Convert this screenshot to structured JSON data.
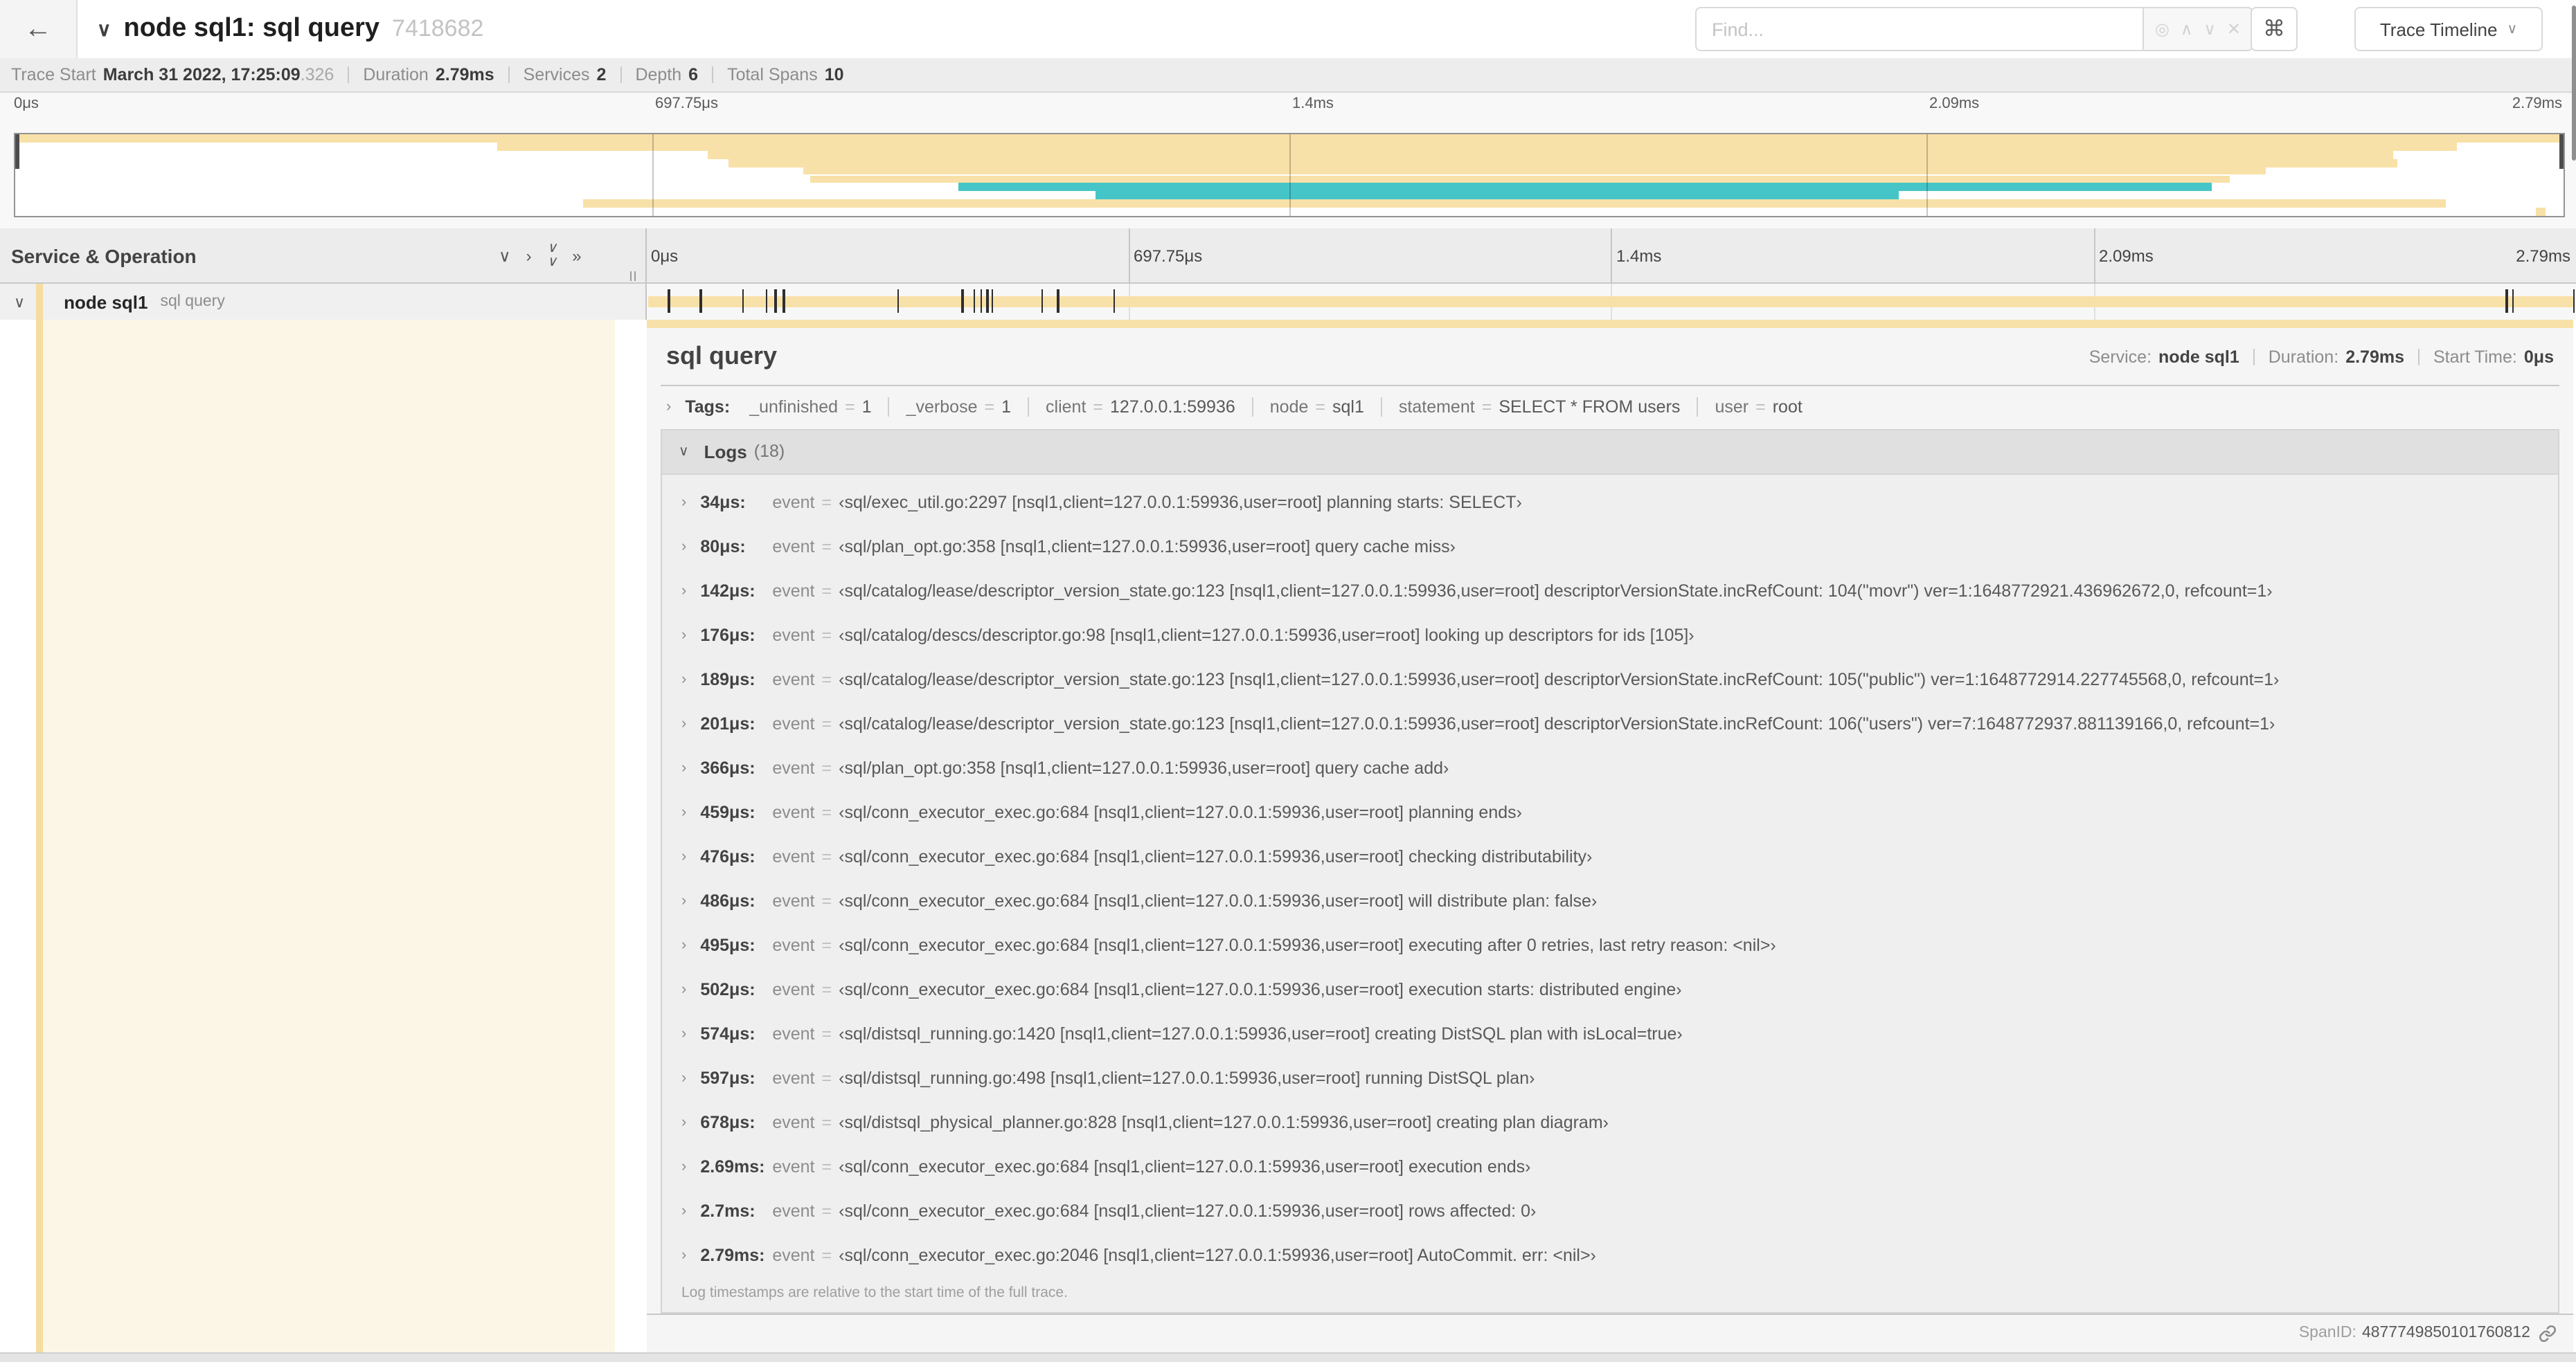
{
  "colors": {
    "tan": "#F8E1A8",
    "teal": "#45C5C8",
    "cream": "#FCF6E7",
    "accent": "#F6DC9F"
  },
  "header": {
    "back_arrow": "←",
    "collapse_chevron": "∨",
    "title": "node sql1: sql query",
    "trace_id": "7418682",
    "find_placeholder": "Find...",
    "shortcut_glyph": "⌘",
    "view_selector": "Trace Timeline"
  },
  "trace_info": {
    "items": [
      {
        "label": "Trace Start",
        "value": "March 31 2022, 17:25:09",
        "suffix": ".326"
      },
      {
        "label": "Duration",
        "value": "2.79ms"
      },
      {
        "label": "Services",
        "value": "2"
      },
      {
        "label": "Depth",
        "value": "6"
      },
      {
        "label": "Total Spans",
        "value": "10"
      }
    ]
  },
  "minimap": {
    "axis": [
      {
        "text": "0μs",
        "pct": 0
      },
      {
        "text": "697.75μs",
        "pct": 25
      },
      {
        "text": "1.4ms",
        "pct": 50
      },
      {
        "text": "2.09ms",
        "pct": 75
      },
      {
        "text": "2.79ms",
        "pct": 100
      }
    ],
    "tick_pcts": [
      25,
      50,
      75
    ],
    "spans": [
      {
        "start": 0,
        "end": 100,
        "color": "tan"
      },
      {
        "start": 18.9,
        "end": 95.8,
        "color": "tan"
      },
      {
        "start": 27.2,
        "end": 93.3,
        "color": "tan"
      },
      {
        "start": 28.0,
        "end": 93.5,
        "color": "tan"
      },
      {
        "start": 30.9,
        "end": 88.3,
        "color": "tan"
      },
      {
        "start": 31.2,
        "end": 86.9,
        "color": "tan"
      },
      {
        "start": 37.0,
        "end": 86.2,
        "color": "teal"
      },
      {
        "start": 42.4,
        "end": 73.9,
        "color": "teal"
      },
      {
        "start": 22.3,
        "end": 95.4,
        "color": "tan"
      },
      {
        "start": 98.9,
        "end": 99.3,
        "color": "tan"
      }
    ]
  },
  "timeline": {
    "left_header": "Service & Operation",
    "ruler": [
      {
        "text": "0μs",
        "pct": 0
      },
      {
        "text": "697.75μs",
        "pct": 25
      },
      {
        "text": "1.4ms",
        "pct": 50
      },
      {
        "text": "2.09ms",
        "pct": 75
      },
      {
        "text": "2.79ms",
        "pct": 100
      }
    ],
    "grid_pcts": [
      25,
      50,
      75
    ],
    "span_row": {
      "collapse_chevron": "∨",
      "service": "node sql1",
      "operation": "sql query",
      "log_marker_pcts": [
        1.22,
        2.87,
        5.09,
        6.31,
        6.77,
        7.2,
        13.12,
        16.45,
        17.06,
        17.42,
        17.74,
        17.99,
        20.57,
        21.4,
        24.3,
        96.42,
        96.77,
        99.9
      ]
    }
  },
  "detail": {
    "title": "sql query",
    "meta": [
      {
        "label": "Service:",
        "value": "node sql1"
      },
      {
        "label": "Duration:",
        "value": "2.79ms"
      },
      {
        "label": "Start Time:",
        "value": "0μs"
      }
    ],
    "tags": {
      "label": "Tags:",
      "items": [
        {
          "key": "_unfinished",
          "value": "1"
        },
        {
          "key": "_verbose",
          "value": "1"
        },
        {
          "key": "client",
          "value": "127.0.0.1:59936"
        },
        {
          "key": "node",
          "value": "sql1"
        },
        {
          "key": "statement",
          "value": "SELECT * FROM users"
        },
        {
          "key": "user",
          "value": "root"
        }
      ]
    },
    "logs": {
      "label": "Logs",
      "count_display": "(18)",
      "entries": [
        {
          "time": "34μs:",
          "key": "event",
          "value": "‹sql/exec_util.go:2297 [nsql1,client=127.0.0.1:59936,user=root] planning starts: SELECT›"
        },
        {
          "time": "80μs:",
          "key": "event",
          "value": "‹sql/plan_opt.go:358 [nsql1,client=127.0.0.1:59936,user=root] query cache miss›"
        },
        {
          "time": "142μs:",
          "key": "event",
          "value": "‹sql/catalog/lease/descriptor_version_state.go:123 [nsql1,client=127.0.0.1:59936,user=root] descriptorVersionState.incRefCount: 104(\"movr\") ver=1:1648772921.436962672,0, refcount=1›"
        },
        {
          "time": "176μs:",
          "key": "event",
          "value": "‹sql/catalog/descs/descriptor.go:98 [nsql1,client=127.0.0.1:59936,user=root] looking up descriptors for ids [105]›"
        },
        {
          "time": "189μs:",
          "key": "event",
          "value": "‹sql/catalog/lease/descriptor_version_state.go:123 [nsql1,client=127.0.0.1:59936,user=root] descriptorVersionState.incRefCount: 105(\"public\") ver=1:1648772914.227745568,0, refcount=1›"
        },
        {
          "time": "201μs:",
          "key": "event",
          "value": "‹sql/catalog/lease/descriptor_version_state.go:123 [nsql1,client=127.0.0.1:59936,user=root] descriptorVersionState.incRefCount: 106(\"users\") ver=7:1648772937.881139166,0, refcount=1›"
        },
        {
          "time": "366μs:",
          "key": "event",
          "value": "‹sql/plan_opt.go:358 [nsql1,client=127.0.0.1:59936,user=root] query cache add›"
        },
        {
          "time": "459μs:",
          "key": "event",
          "value": "‹sql/conn_executor_exec.go:684 [nsql1,client=127.0.0.1:59936,user=root] planning ends›"
        },
        {
          "time": "476μs:",
          "key": "event",
          "value": "‹sql/conn_executor_exec.go:684 [nsql1,client=127.0.0.1:59936,user=root] checking distributability›"
        },
        {
          "time": "486μs:",
          "key": "event",
          "value": "‹sql/conn_executor_exec.go:684 [nsql1,client=127.0.0.1:59936,user=root] will distribute plan: false›"
        },
        {
          "time": "495μs:",
          "key": "event",
          "value": "‹sql/conn_executor_exec.go:684 [nsql1,client=127.0.0.1:59936,user=root] executing after 0 retries, last retry reason: <nil>›"
        },
        {
          "time": "502μs:",
          "key": "event",
          "value": "‹sql/conn_executor_exec.go:684 [nsql1,client=127.0.0.1:59936,user=root] execution starts: distributed engine›"
        },
        {
          "time": "574μs:",
          "key": "event",
          "value": "‹sql/distsql_running.go:1420 [nsql1,client=127.0.0.1:59936,user=root] creating DistSQL plan with isLocal=true›"
        },
        {
          "time": "597μs:",
          "key": "event",
          "value": "‹sql/distsql_running.go:498 [nsql1,client=127.0.0.1:59936,user=root] running DistSQL plan›"
        },
        {
          "time": "678μs:",
          "key": "event",
          "value": "‹sql/distsql_physical_planner.go:828 [nsql1,client=127.0.0.1:59936,user=root] creating plan diagram›"
        },
        {
          "time": "2.69ms:",
          "key": "event",
          "value": "‹sql/conn_executor_exec.go:684 [nsql1,client=127.0.0.1:59936,user=root] execution ends›"
        },
        {
          "time": "2.7ms:",
          "key": "event",
          "value": "‹sql/conn_executor_exec.go:684 [nsql1,client=127.0.0.1:59936,user=root] rows affected: 0›"
        },
        {
          "time": "2.79ms:",
          "key": "event",
          "value": "‹sql/conn_executor_exec.go:2046 [nsql1,client=127.0.0.1:59936,user=root] AutoCommit. err: <nil>›"
        }
      ],
      "footnote": "Log timestamps are relative to the start time of the full trace."
    },
    "span_id_label": "SpanID:",
    "span_id": "4877749850101760812"
  }
}
